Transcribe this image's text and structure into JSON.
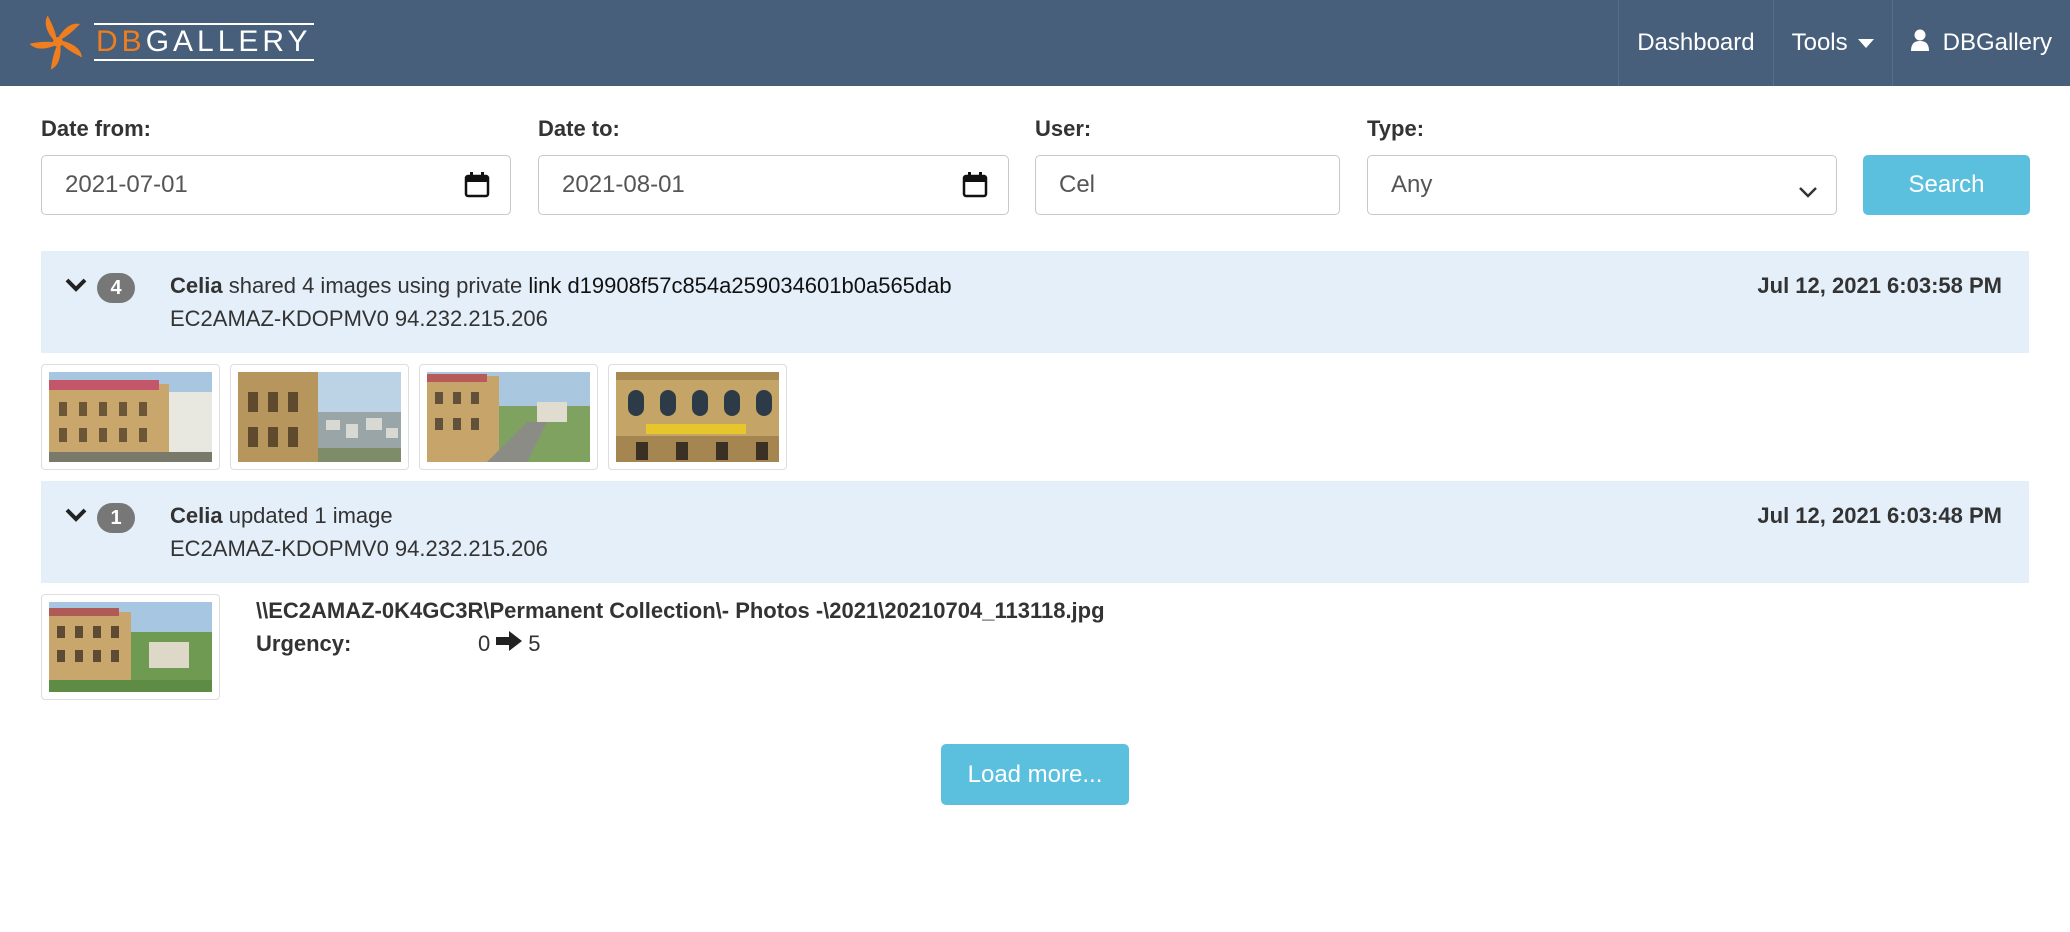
{
  "brand": {
    "logo_text_part1": "DB",
    "logo_text_part2": "GALLERY"
  },
  "nav": {
    "dashboard": "Dashboard",
    "tools": "Tools",
    "user": "DBGallery"
  },
  "filters": {
    "date_from_label": "Date from:",
    "date_from_value": "2021-07-01",
    "date_to_label": "Date to:",
    "date_to_value": "2021-08-01",
    "user_label": "User:",
    "user_value": "Cel",
    "type_label": "Type:",
    "type_value": "Any",
    "search_button": "Search"
  },
  "activities": [
    {
      "count": "4",
      "user": "Celia",
      "action": " shared 4 images using private ",
      "link_text": "link d19908f57c854a259034601b0a565dab",
      "machine": "EC2AMAZ-KDOPMV0 94.232.215.206",
      "timestamp": "Jul 12, 2021 6:03:58 PM"
    },
    {
      "count": "1",
      "user": "Celia",
      "action": " updated 1 image",
      "machine": "EC2AMAZ-KDOPMV0 94.232.215.206",
      "timestamp": "Jul 12, 2021 6:03:48 PM",
      "file_path": "\\\\EC2AMAZ-0K4GC3R\\Permanent Collection\\- Photos -\\2021\\20210704_113118.jpg",
      "field_label": "Urgency:",
      "old_value": "0",
      "new_value": "5"
    }
  ],
  "load_more": "Load more...",
  "colors": {
    "navbar": "#475f7a",
    "accent": "#5bc0de",
    "group_header": "#e4eff9",
    "badge": "#777777",
    "logo_orange": "#f07e1e"
  }
}
